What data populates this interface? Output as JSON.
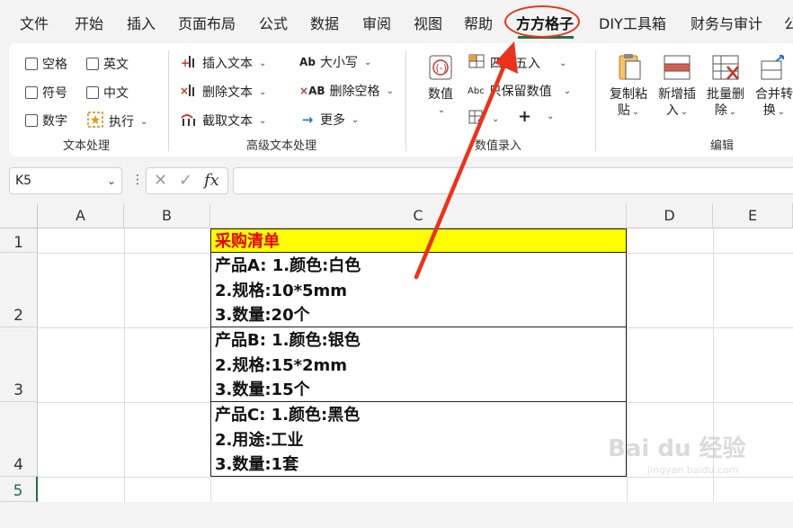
{
  "menu": {
    "tabs": [
      "文件",
      "开始",
      "插入",
      "页面布局",
      "公式",
      "数据",
      "审阅",
      "视图",
      "帮助",
      "方方格子",
      "DIY工具箱",
      "财务与审计",
      "公"
    ],
    "active_tab": "方方格子"
  },
  "ribbon": {
    "text_group": {
      "label": "文本处理",
      "checkboxes": [
        "空格",
        "英文",
        "符号",
        "中文",
        "数字"
      ],
      "execute_label": "执行"
    },
    "advanced_group": {
      "label": "高级文本处理",
      "insert_text": "插入文本",
      "delete_text": "删除文本",
      "cut_text": "截取文本",
      "case": "大小写",
      "delete_space": "删除空格",
      "more": "更多"
    },
    "value_group": {
      "label": "数值录入",
      "value_label": "数值",
      "round_label": "四舍五入",
      "keep_value_label": "只保留数值",
      "plus": "+"
    },
    "edit_group": {
      "label": "编辑",
      "copy_paste": [
        "复制粘",
        "贴"
      ],
      "new_insert": [
        "新增插",
        "入"
      ],
      "batch_delete": [
        "批量删",
        "除"
      ],
      "merge_convert": [
        "合并转",
        "换"
      ]
    }
  },
  "formula_bar": {
    "cell_ref": "K5",
    "dots": "⋮",
    "cancel": "✕",
    "confirm": "✓",
    "fx": "fx",
    "value": ""
  },
  "grid": {
    "columns": [
      "A",
      "B",
      "C",
      "D",
      "E"
    ],
    "rows": [
      "1",
      "2",
      "3",
      "4",
      "5"
    ],
    "c1": "采购清单",
    "c2": [
      "产品A: 1.颜色:白色",
      "2.规格:10*5mm",
      "3.数量:20个"
    ],
    "c3": [
      "产品B: 1.颜色:银色",
      "2.规格:15*2mm",
      "3.数量:15个"
    ],
    "c4": [
      "产品C: 1.颜色:黑色",
      "2.用途:工业",
      "3.数量:1套"
    ]
  },
  "watermark": {
    "logo": "Bai du 经验",
    "sub": "jingyan.baidu.com"
  },
  "colors": {
    "accent": "#1e7145",
    "highlight_circle": "#e8341c",
    "title_fill": "#ffff00",
    "title_text": "#e60000"
  }
}
